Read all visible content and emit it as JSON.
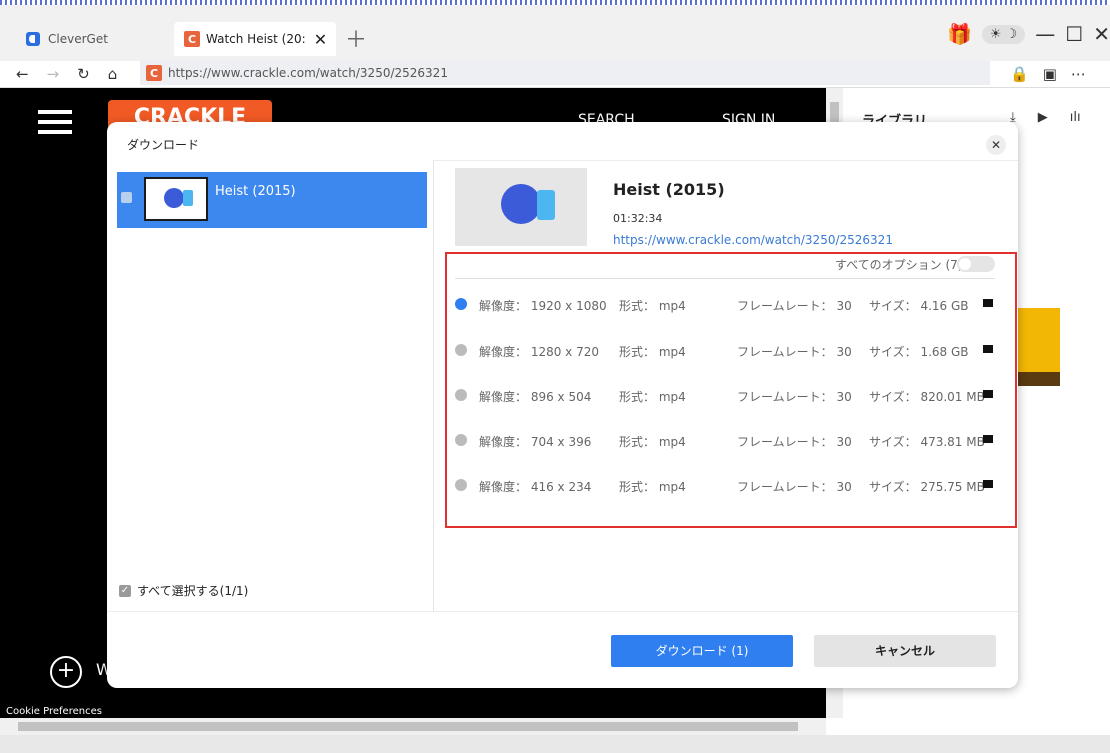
{
  "browser": {
    "tabs": [
      {
        "label": "CleverGet"
      },
      {
        "label": "Watch Heist (20:"
      }
    ],
    "url": "https://www.crackle.com/watch/3250/2526321"
  },
  "page": {
    "logo_text": "CRACKLE",
    "search_label": "SEARCH",
    "signin_label": "SIGN IN",
    "w_text": "W",
    "cookie_text": "Cookie Preferences"
  },
  "library": {
    "title": "ライブラリ"
  },
  "dialog": {
    "title": "ダウンロード",
    "item_name": "Heist (2015)",
    "select_all": "すべて選択する(1/1)",
    "video_title": "Heist (2015)",
    "duration": "01:32:34",
    "url": "https://www.crackle.com/watch/3250/2526321",
    "all_options": "すべてのオプション (7)",
    "options": [
      {
        "resolution": "解像度： 1920 x 1080",
        "format": "形式： mp4",
        "framerate": "フレームレート： 30",
        "size": "サイズ： 4.16 GB",
        "selected": true
      },
      {
        "resolution": "解像度： 1280 x 720",
        "format": "形式： mp4",
        "framerate": "フレームレート： 30",
        "size": "サイズ： 1.68 GB",
        "selected": false
      },
      {
        "resolution": "解像度： 896 x 504",
        "format": "形式： mp4",
        "framerate": "フレームレート： 30",
        "size": "サイズ： 820.01 MB",
        "selected": false
      },
      {
        "resolution": "解像度： 704 x 396",
        "format": "形式： mp4",
        "framerate": "フレームレート： 30",
        "size": "サイズ： 473.81 MB",
        "selected": false
      },
      {
        "resolution": "解像度： 416 x 234",
        "format": "形式： mp4",
        "framerate": "フレームレート： 30",
        "size": "サイズ： 275.75 MB",
        "selected": false
      }
    ],
    "download_btn": "ダウンロード (1)",
    "cancel_btn": "キャンセル"
  },
  "colors": {
    "accent": "#2f7ff0",
    "highlight_border": "#e03030",
    "crackle_orange": "#f15a24"
  }
}
